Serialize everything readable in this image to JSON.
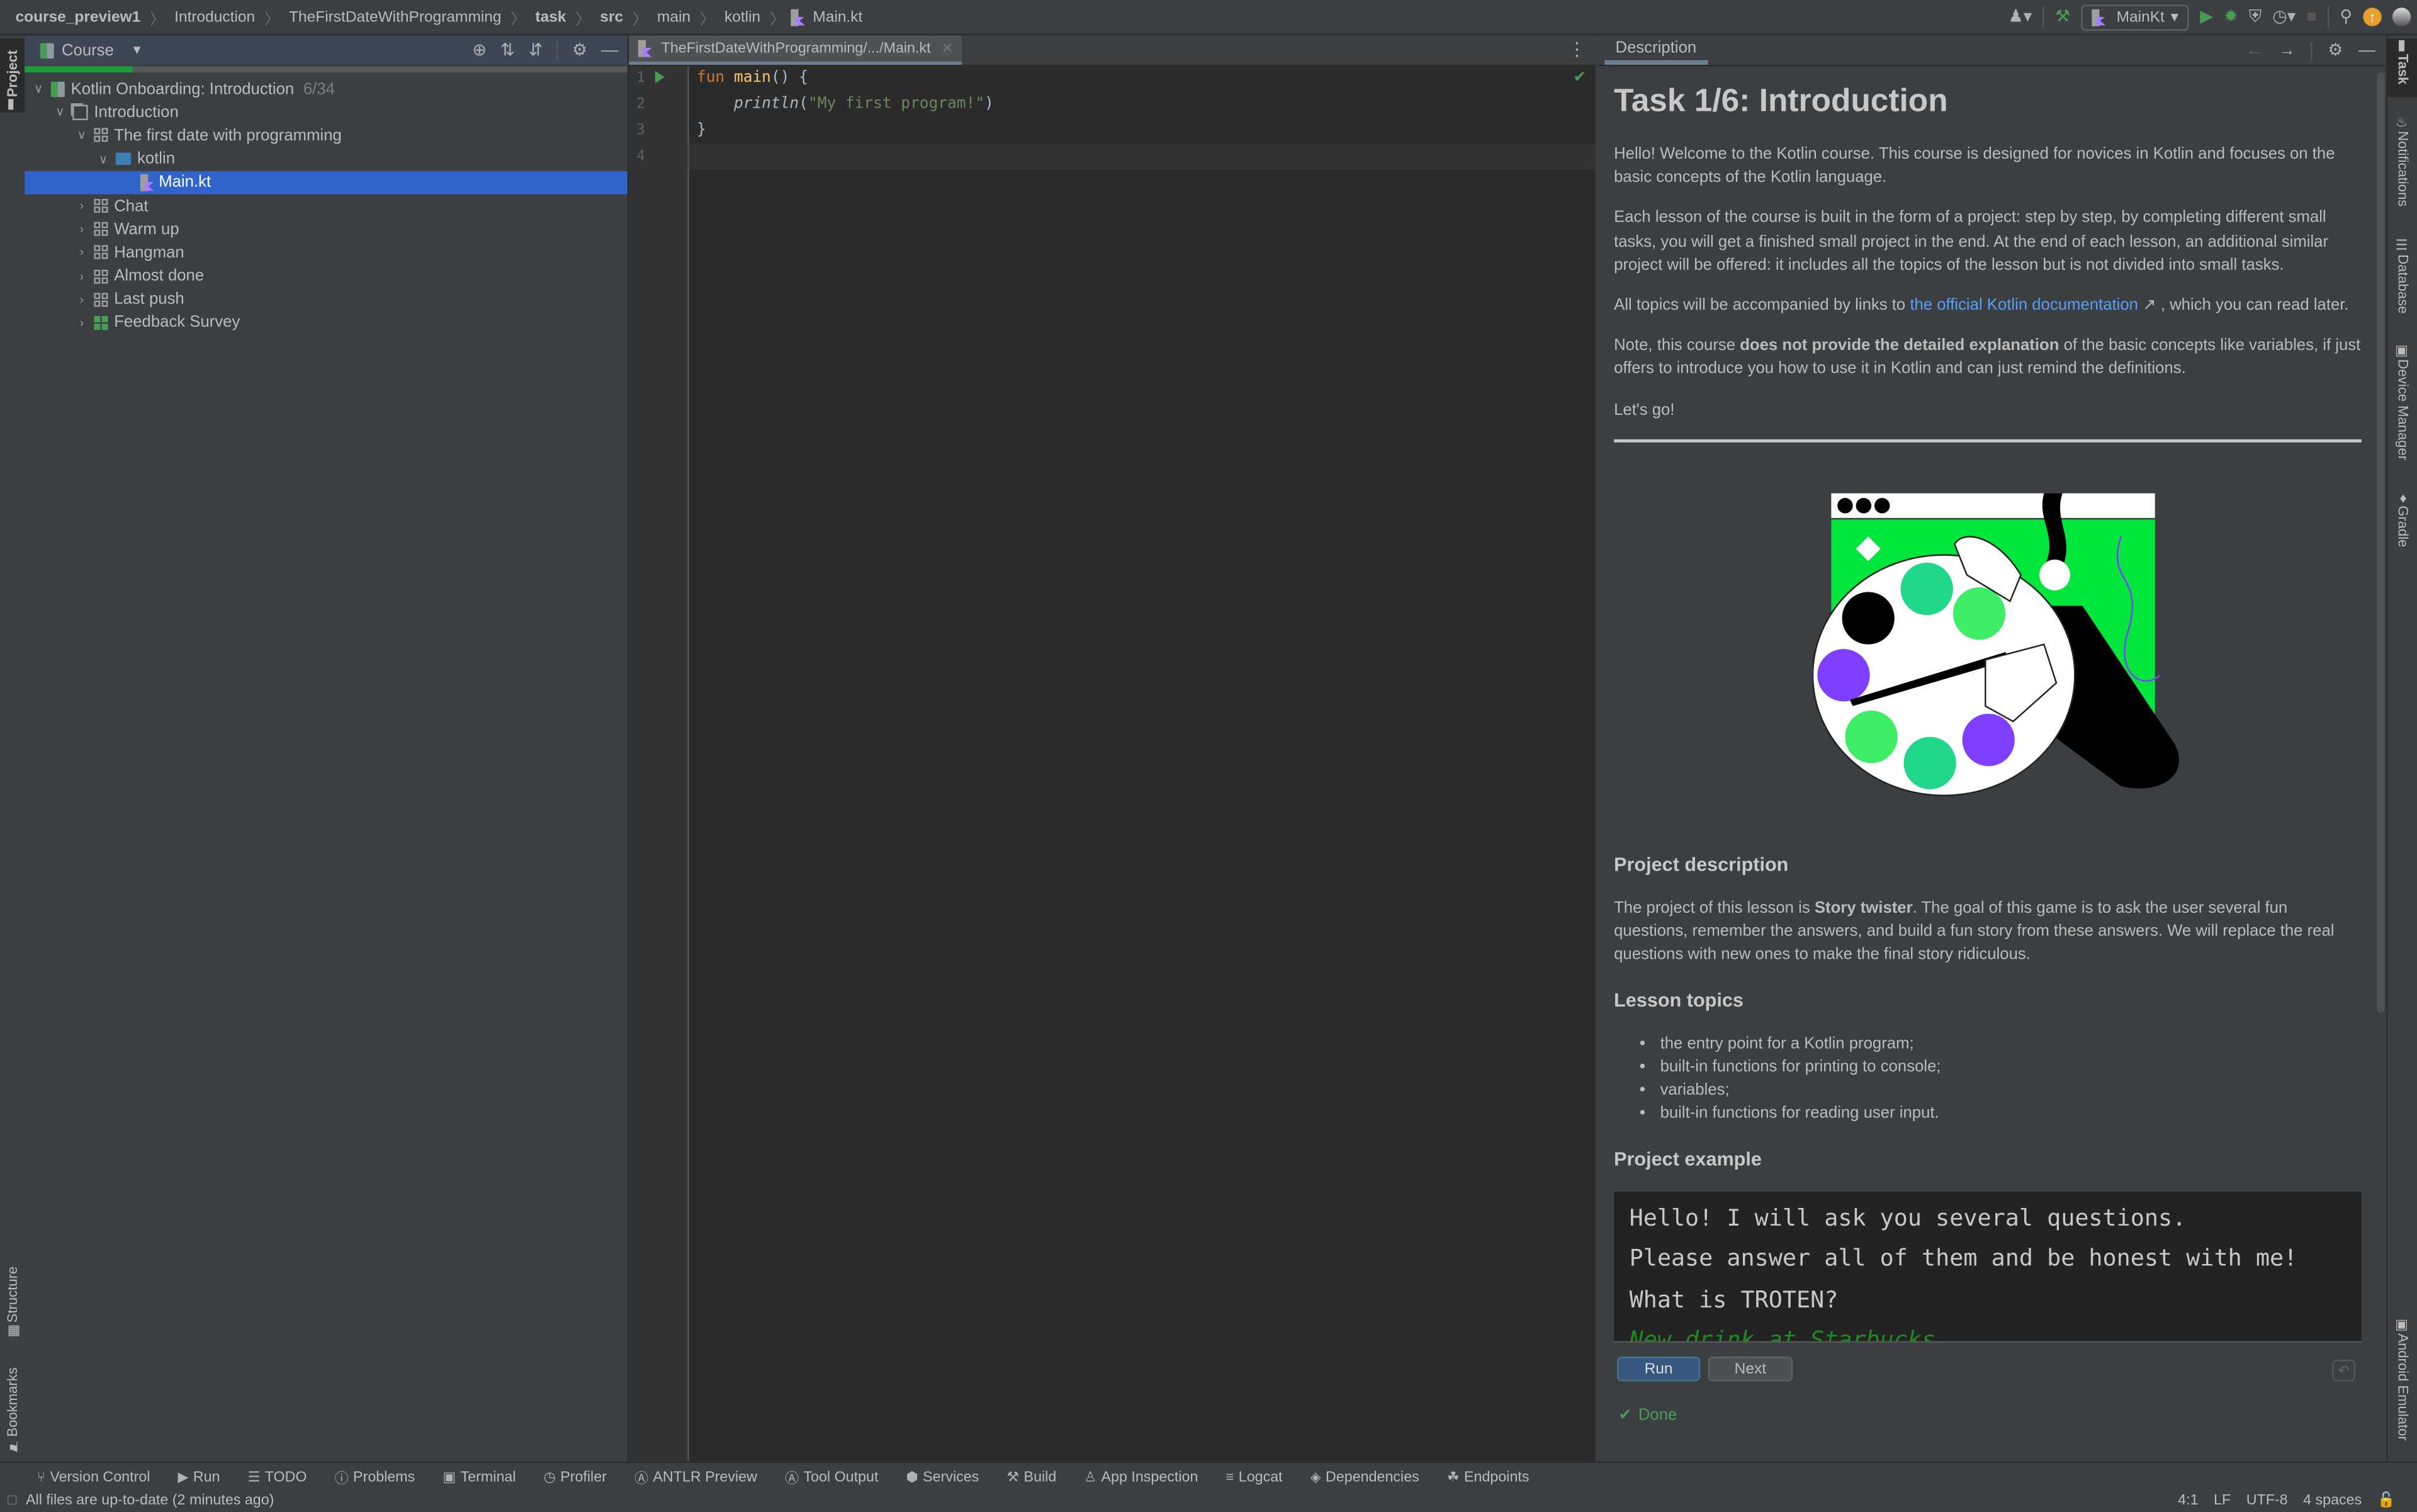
{
  "titlebar": {
    "breadcrumb": [
      {
        "label": "course_preview1",
        "bold": true
      },
      {
        "label": "Introduction",
        "bold": false
      },
      {
        "label": "TheFirstDateWithProgramming",
        "bold": false
      },
      {
        "label": "task",
        "bold": true
      },
      {
        "label": "src",
        "bold": true
      },
      {
        "label": "main",
        "bold": false
      },
      {
        "label": "kotlin",
        "bold": false
      },
      {
        "label": "Main.kt",
        "bold": false
      }
    ],
    "run_config": "MainKt",
    "icons": [
      "user-icon",
      "build-hammer-icon",
      "run-icon",
      "debug-icon",
      "coverage-icon",
      "profile-icon",
      "stop-icon",
      "search-icon",
      "update-icon",
      "avatar"
    ]
  },
  "left_strip": {
    "top": "Project",
    "structure": "Structure",
    "bookmarks": "Bookmarks"
  },
  "project_panel": {
    "title": "Course",
    "progress": 0.18,
    "tree": [
      {
        "label": "Kotlin Onboarding: Introduction",
        "meta": "6/34",
        "depth": 0,
        "expanded": true,
        "icon": "course"
      },
      {
        "label": "Introduction",
        "depth": 1,
        "expanded": true,
        "icon": "section"
      },
      {
        "label": "The first date with programming",
        "depth": 2,
        "expanded": true,
        "icon": "lesson"
      },
      {
        "label": "kotlin",
        "depth": 3,
        "expanded": true,
        "icon": "folder"
      },
      {
        "label": "Main.kt",
        "depth": 4,
        "icon": "kotlin-file",
        "selected": true
      },
      {
        "label": "Chat",
        "depth": 2,
        "expanded": false,
        "icon": "lesson"
      },
      {
        "label": "Warm up",
        "depth": 2,
        "expanded": false,
        "icon": "lesson"
      },
      {
        "label": "Hangman",
        "depth": 2,
        "expanded": false,
        "icon": "lesson"
      },
      {
        "label": "Almost done",
        "depth": 2,
        "expanded": false,
        "icon": "lesson"
      },
      {
        "label": "Last push",
        "depth": 2,
        "expanded": false,
        "icon": "lesson"
      },
      {
        "label": "Feedback Survey",
        "depth": 2,
        "expanded": false,
        "icon": "lesson-green"
      }
    ]
  },
  "editor": {
    "tab_label": "TheFirstDateWithProgramming/.../Main.kt",
    "line_numbers": [
      "1",
      "2",
      "3",
      "4"
    ],
    "code": {
      "l1_kw": "fun",
      "l1_fn": "main",
      "l1_rest": "() {",
      "l2_fn": "println",
      "l2_open": "(",
      "l2_str": "\"My first program!\"",
      "l2_close": ")",
      "l3": "}"
    }
  },
  "description": {
    "tab": "Description",
    "title": "Task 1/6: Introduction",
    "p1": "Hello! Welcome to the Kotlin course. This course is designed for novices in Kotlin and focuses on the basic concepts of the Kotlin language.",
    "p2": "Each lesson of the course is built in the form of a project: step by step, by completing different small tasks, you will get a finished small project in the end. At the end of each lesson, an additional similar project will be offered: it includes all the topics of the lesson but is not divided into small tasks.",
    "p3_before": "All topics will be accompanied by links to ",
    "p3_link": "the official Kotlin documentation",
    "p3_after": " ↗ , which you can read later.",
    "p4_before": "Note, this course ",
    "p4_bold": "does not provide the detailed explanation",
    "p4_after": " of the basic concepts like variables, if just offers to introduce you how to use it in Kotlin and can just remind the definitions.",
    "p5": "Let's go!",
    "h_project": "Project description",
    "proj_before": "The project of this lesson is ",
    "proj_bold": "Story twister",
    "proj_after": ". The goal of this game is to ask the user several fun questions, remember the answers, and build a fun story from these answers. We will replace the real questions with new ones to make the final story ridiculous.",
    "h_topics": "Lesson topics",
    "topics": [
      "the entry point for a Kotlin program;",
      "built-in functions for printing to console;",
      "variables;",
      "built-in functions for reading user input."
    ],
    "h_example": "Project example",
    "example_lines": [
      "Hello! I will ask you several questions.",
      "Please answer all of them and be honest with me!",
      "What is TROTEN?"
    ],
    "example_answer": "New drink at Starbucks",
    "run_label": "Run",
    "next_label": "Next",
    "status": "Done"
  },
  "right_strip": [
    "Task",
    "Notifications",
    "Database",
    "Device Manager",
    "Gradle",
    "Android Emulator"
  ],
  "bottom_tools": [
    {
      "label": "Version Control",
      "icon": "version-control-icon",
      "glyph": "⑂"
    },
    {
      "label": "Run",
      "icon": "run-icon",
      "glyph": "▶"
    },
    {
      "label": "TODO",
      "icon": "todo-icon",
      "glyph": "☰"
    },
    {
      "label": "Problems",
      "icon": "problems-icon",
      "glyph": "ⓘ"
    },
    {
      "label": "Terminal",
      "icon": "terminal-icon",
      "glyph": "▣"
    },
    {
      "label": "Profiler",
      "icon": "profiler-icon",
      "glyph": "◷"
    },
    {
      "label": "ANTLR Preview",
      "icon": "antlr-icon",
      "glyph": "Ⓐ"
    },
    {
      "label": "Tool Output",
      "icon": "antlr-tool-icon",
      "glyph": "Ⓐ"
    },
    {
      "label": "Services",
      "icon": "services-icon",
      "glyph": "⬢"
    },
    {
      "label": "Build",
      "icon": "build-icon",
      "glyph": "⚒"
    },
    {
      "label": "App Inspection",
      "icon": "app-inspection-icon",
      "glyph": "♙"
    },
    {
      "label": "Logcat",
      "icon": "logcat-icon",
      "glyph": "≡"
    },
    {
      "label": "Dependencies",
      "icon": "dependencies-icon",
      "glyph": "◈"
    },
    {
      "label": "Endpoints",
      "icon": "endpoints-icon",
      "glyph": "☘"
    }
  ],
  "status_bar": {
    "message": "All files are up-to-date (2 minutes ago)",
    "position": "4:1",
    "line_sep": "LF",
    "encoding": "UTF-8",
    "indent": "4 spaces"
  },
  "colors": {
    "accent": "#2f65ca",
    "green": "#499c54",
    "link": "#589df6",
    "run_button": "#365880"
  }
}
